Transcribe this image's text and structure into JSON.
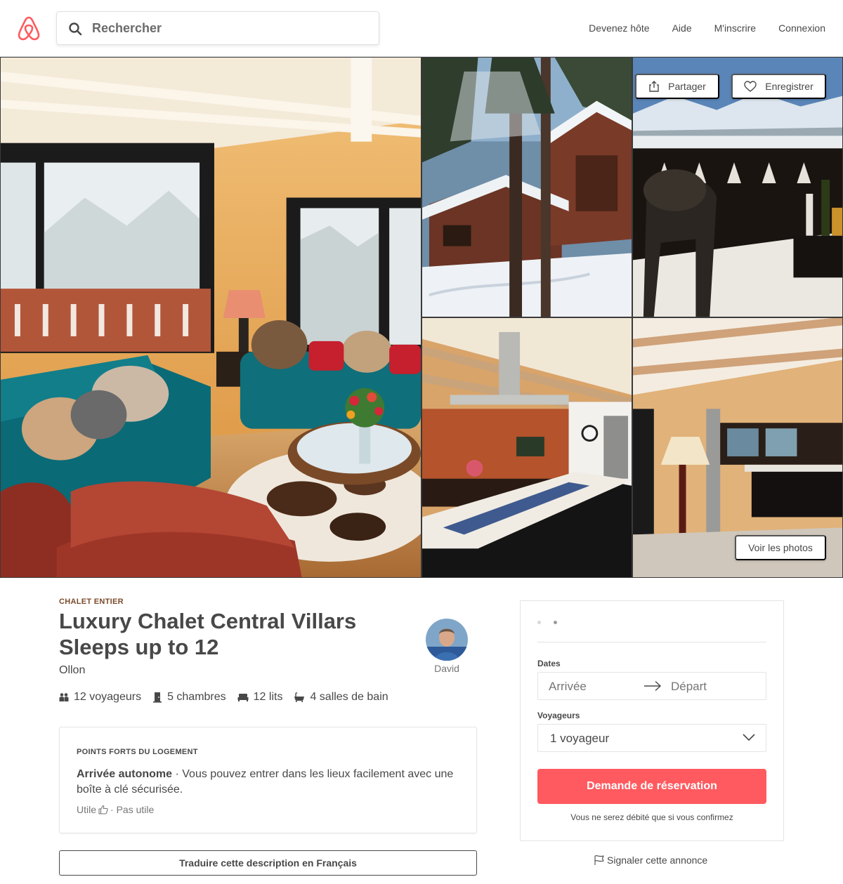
{
  "header": {
    "search_placeholder": "Rechercher",
    "nav": [
      "Devenez hôte",
      "Aide",
      "M'inscrire",
      "Connexion"
    ]
  },
  "gallery": {
    "share_label": "Partager",
    "save_label": "Enregistrer",
    "view_photos_label": "Voir les photos"
  },
  "listing": {
    "kicker": "CHALET ENTIER",
    "title": "Luxury Chalet Central Villars Sleeps up to 12",
    "location": "Ollon",
    "host_name": "David",
    "amenities": {
      "guests": "12 voyageurs",
      "bedrooms": "5 chambres",
      "beds": "12 lits",
      "baths": "4 salles de bain"
    }
  },
  "highlights": {
    "title": "POINTS FORTS DU LOGEMENT",
    "item_title": "Arrivée autonome",
    "item_sep": " · ",
    "item_text": "Vous pouvez entrer dans les lieux facilement avec une boîte à clé sécurisée.",
    "useful": "Utile",
    "not_useful": "· Pas utile"
  },
  "translate_label": "Traduire cette description en Français",
  "booking": {
    "dates_label": "Dates",
    "checkin_placeholder": "Arrivée",
    "checkout_placeholder": "Départ",
    "guests_label": "Voyageurs",
    "guests_value": "1 voyageur",
    "reserve_label": "Demande de réservation",
    "charge_note": "Vous ne serez débité que si vous confirmez"
  },
  "report_label": "Signaler cette annonce",
  "colors": {
    "brand": "#ff5a5f",
    "text": "#484848",
    "muted": "#767676",
    "kicker": "#7a4a2a"
  }
}
